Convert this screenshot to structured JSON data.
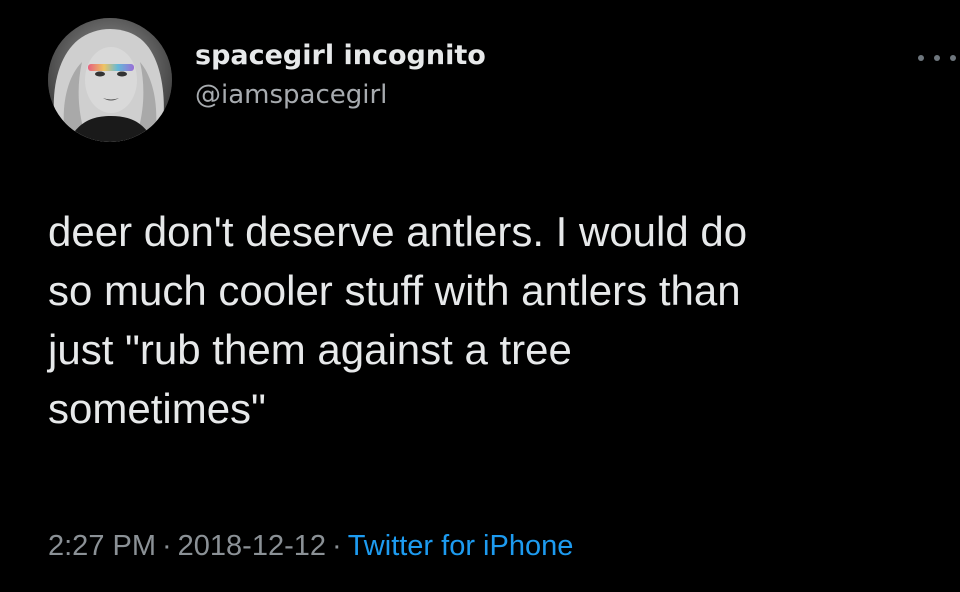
{
  "user": {
    "display_name": "spacegirl incognito",
    "handle": "@iamspacegirl"
  },
  "tweet": {
    "lines": [
      "deer don't deserve antlers. I would do",
      "so much cooler stuff with antlers than",
      "just \"rub them against a tree",
      "sometimes\""
    ],
    "time": "2:27 PM",
    "date": "2018-12-12",
    "separator": "·",
    "source": "Twitter for iPhone"
  },
  "icons": {
    "more": "more-options-icon",
    "avatar": "profile-avatar"
  },
  "colors": {
    "background": "#000000",
    "text": "#e7e9ea",
    "secondary": "#8b9196",
    "link": "#1d9bf0"
  }
}
